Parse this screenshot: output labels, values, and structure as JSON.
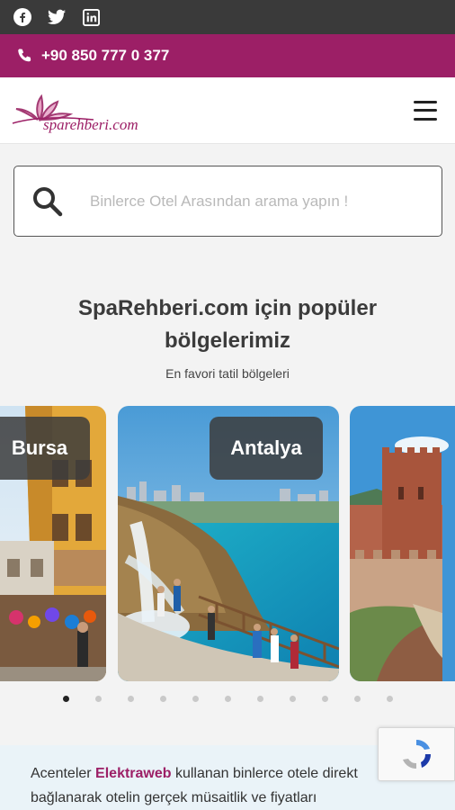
{
  "social": [
    {
      "icon": "facebook-icon"
    },
    {
      "icon": "twitter-icon"
    },
    {
      "icon": "linkedin-icon"
    }
  ],
  "contact": {
    "phone": "+90 850 777 0 377",
    "icon": "phone-icon"
  },
  "brand": {
    "logo_text": "sparehberi.com",
    "color": "#9c1f66"
  },
  "search": {
    "placeholder": "Binlerce Otel Arasından arama yapın !"
  },
  "regions": {
    "title_line1": "SpaRehberi.com için popüler",
    "title_line2": "bölgelerimiz",
    "subtitle": "En favori tatil bölgeleri",
    "cards": [
      {
        "label": "Bursa"
      },
      {
        "label": "Antalya"
      },
      {
        "label": ""
      }
    ],
    "dot_count": 11,
    "active_dot": 0
  },
  "info": {
    "prefix": "Acenteler ",
    "brand": "Elektraweb",
    "suffix": " kullanan binlerce otele direkt bağlanarak otelin gerçek müsaitlik ve fiyatları"
  },
  "colors": {
    "accent": "#9c1f66",
    "topbar": "#3a3a3a"
  }
}
